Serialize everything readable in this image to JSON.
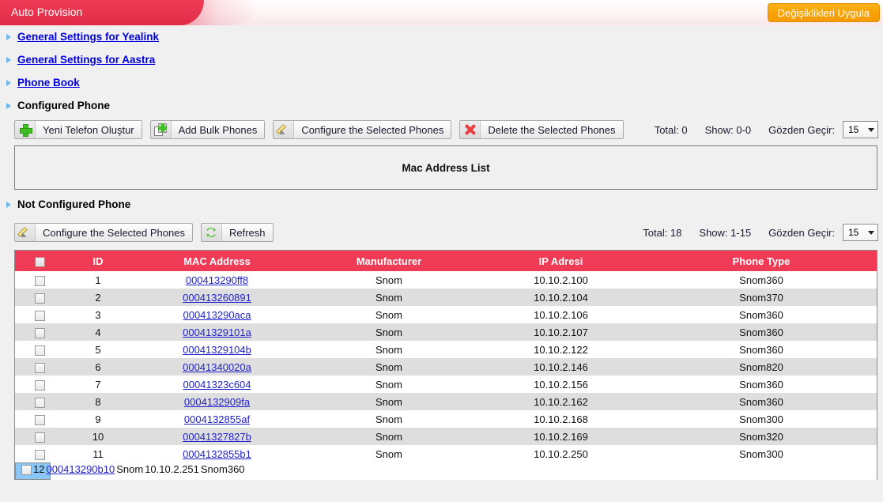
{
  "header": {
    "tab_title": "Auto Provision",
    "apply_button": "Değişiklikleri Uygula"
  },
  "nav": {
    "items": [
      {
        "label": "General Settings for Yealink",
        "link": true
      },
      {
        "label": "General Settings for Aastra",
        "link": true
      },
      {
        "label": "Phone Book",
        "link": true
      },
      {
        "label": "Configured Phone",
        "link": false
      }
    ]
  },
  "configured_section": {
    "buttons": [
      {
        "label": "Yeni Telefon Oluştur",
        "icon": "plus-icon"
      },
      {
        "label": "Add Bulk Phones",
        "icon": "pages-plus-icon"
      },
      {
        "label": "Configure the Selected Phones",
        "icon": "pencil-icon"
      },
      {
        "label": "Delete the Selected Phones",
        "icon": "delete-x-icon"
      }
    ],
    "pager": {
      "total_label": "Total: 0",
      "show_label": "Show: 0-0",
      "per_page_label": "Gözden Geçir:",
      "per_page_value": "15"
    },
    "panel_title": "Mac Address List"
  },
  "not_configured_section": {
    "heading": "Not Configured Phone",
    "buttons": [
      {
        "label": "Configure the Selected Phones",
        "icon": "pencil-icon"
      },
      {
        "label": "Refresh",
        "icon": "refresh-icon"
      }
    ],
    "pager": {
      "total_label": "Total: 18",
      "show_label": "Show: 1-15",
      "per_page_label": "Gözden Geçir:",
      "per_page_value": "15"
    },
    "table": {
      "columns": [
        "",
        "ID",
        "MAC Address",
        "Manufacturer",
        "IP Adresi",
        "Phone Type"
      ],
      "rows": [
        {
          "id": "1",
          "mac": "000413290ff8",
          "manufacturer": "Snom",
          "ip": "10.10.2.100",
          "type": "Snom360",
          "selected": false
        },
        {
          "id": "2",
          "mac": "000413260891",
          "manufacturer": "Snom",
          "ip": "10.10.2.104",
          "type": "Snom370",
          "selected": false
        },
        {
          "id": "3",
          "mac": "000413290aca",
          "manufacturer": "Snom",
          "ip": "10.10.2.106",
          "type": "Snom360",
          "selected": false
        },
        {
          "id": "4",
          "mac": "00041329101a",
          "manufacturer": "Snom",
          "ip": "10.10.2.107",
          "type": "Snom360",
          "selected": false
        },
        {
          "id": "5",
          "mac": "00041329104b",
          "manufacturer": "Snom",
          "ip": "10.10.2.122",
          "type": "Snom360",
          "selected": false
        },
        {
          "id": "6",
          "mac": "00041340020a",
          "manufacturer": "Snom",
          "ip": "10.10.2.146",
          "type": "Snom820",
          "selected": false
        },
        {
          "id": "7",
          "mac": "00041323c604",
          "manufacturer": "Snom",
          "ip": "10.10.2.156",
          "type": "Snom360",
          "selected": false
        },
        {
          "id": "8",
          "mac": "0004132909fa",
          "manufacturer": "Snom",
          "ip": "10.10.2.162",
          "type": "Snom360",
          "selected": false
        },
        {
          "id": "9",
          "mac": "0004132855af",
          "manufacturer": "Snom",
          "ip": "10.10.2.168",
          "type": "Snom300",
          "selected": false
        },
        {
          "id": "10",
          "mac": "00041327827b",
          "manufacturer": "Snom",
          "ip": "10.10.2.169",
          "type": "Snom320",
          "selected": false
        },
        {
          "id": "11",
          "mac": "0004132855b1",
          "manufacturer": "Snom",
          "ip": "10.10.2.250",
          "type": "Snom300",
          "selected": false
        },
        {
          "id": "12",
          "mac": "000413290b10",
          "manufacturer": "Snom",
          "ip": "10.10.2.251",
          "type": "Snom360",
          "selected": true
        }
      ]
    }
  },
  "colors": {
    "accent_red": "#ef3b56",
    "apply_orange": "#f8a307",
    "link_blue": "#0000e0",
    "row_selected": "#8cc6f5"
  }
}
